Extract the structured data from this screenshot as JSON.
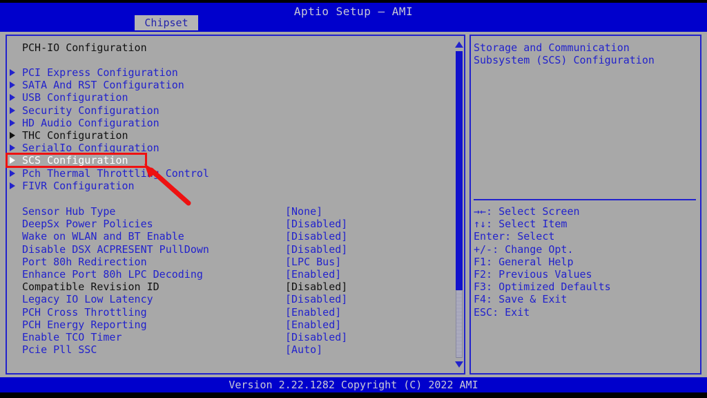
{
  "window": {
    "title": "Aptio Setup – AMI",
    "tab": "Chipset"
  },
  "left_panel": {
    "section_title": "PCH-IO Configuration",
    "menu_items": [
      {
        "label": "PCI Express Configuration",
        "style": "blue",
        "marker": "triangle-right-icon"
      },
      {
        "label": "SATA And RST Configuration",
        "style": "blue",
        "marker": "triangle-right-icon"
      },
      {
        "label": "USB Configuration",
        "style": "blue",
        "marker": "triangle-right-icon"
      },
      {
        "label": "Security Configuration",
        "style": "blue",
        "marker": "triangle-right-icon"
      },
      {
        "label": "HD Audio Configuration",
        "style": "blue",
        "marker": "triangle-right-icon"
      },
      {
        "label": "THC Configuration",
        "style": "dark",
        "marker": "triangle-right-icon"
      },
      {
        "label": "SerialIo Configuration",
        "style": "blue",
        "marker": "triangle-right-icon"
      },
      {
        "label": "SCS Configuration",
        "style": "selected",
        "marker": "triangle-right-icon"
      },
      {
        "label": "Pch Thermal Throttling Control",
        "style": "blue",
        "marker": "triangle-right-icon"
      },
      {
        "label": "FIVR Configuration",
        "style": "blue",
        "marker": "triangle-right-icon"
      }
    ],
    "settings": [
      {
        "label": "Sensor Hub Type",
        "value": "[None]",
        "style": "blue"
      },
      {
        "label": "DeepSx Power Policies",
        "value": "[Disabled]",
        "style": "blue"
      },
      {
        "label": "Wake on WLAN and BT Enable",
        "value": "[Disabled]",
        "style": "blue"
      },
      {
        "label": "Disable DSX ACPRESENT PullDown",
        "value": "[Disabled]",
        "style": "blue"
      },
      {
        "label": "Port 80h Redirection",
        "value": "[LPC Bus]",
        "style": "blue"
      },
      {
        "label": "Enhance Port 80h LPC Decoding",
        "value": "[Enabled]",
        "style": "blue"
      },
      {
        "label": "Compatible Revision ID",
        "value": "[Disabled]",
        "style": "dark"
      },
      {
        "label": "Legacy IO Low Latency",
        "value": "[Disabled]",
        "style": "blue"
      },
      {
        "label": "PCH Cross Throttling",
        "value": "[Enabled]",
        "style": "blue"
      },
      {
        "label": "PCH Energy Reporting",
        "value": "[Enabled]",
        "style": "blue"
      },
      {
        "label": "Enable TCO Timer",
        "value": "[Disabled]",
        "style": "blue"
      },
      {
        "label": "Pcie Pll SSC",
        "value": "[Auto]",
        "style": "blue"
      }
    ]
  },
  "right_panel": {
    "help_text": "Storage and Communication\nSubsystem (SCS) Configuration",
    "keys": [
      "→←: Select Screen",
      "↑↓: Select Item",
      "Enter: Select",
      "+/-: Change Opt.",
      "F1: General Help",
      "F2: Previous Values",
      "F3: Optimized Defaults",
      "F4: Save & Exit",
      "ESC: Exit"
    ]
  },
  "scrollbar": {
    "up_arrow": "scroll-up-arrow-icon",
    "down_arrow": "scroll-down-arrow-icon"
  },
  "footer": {
    "version_text": "Version 2.22.1282 Copyright (C) 2022 AMI"
  },
  "annotation": {
    "color": "#EE1111",
    "target_label": "SCS Configuration"
  },
  "colors": {
    "title_bar": "#0000CC",
    "panel_bg": "#A8A8A8",
    "text_blue": "#2222CC",
    "text_dark": "#111111",
    "text_selected": "#FFFFFF",
    "annotation_red": "#EE1111"
  }
}
